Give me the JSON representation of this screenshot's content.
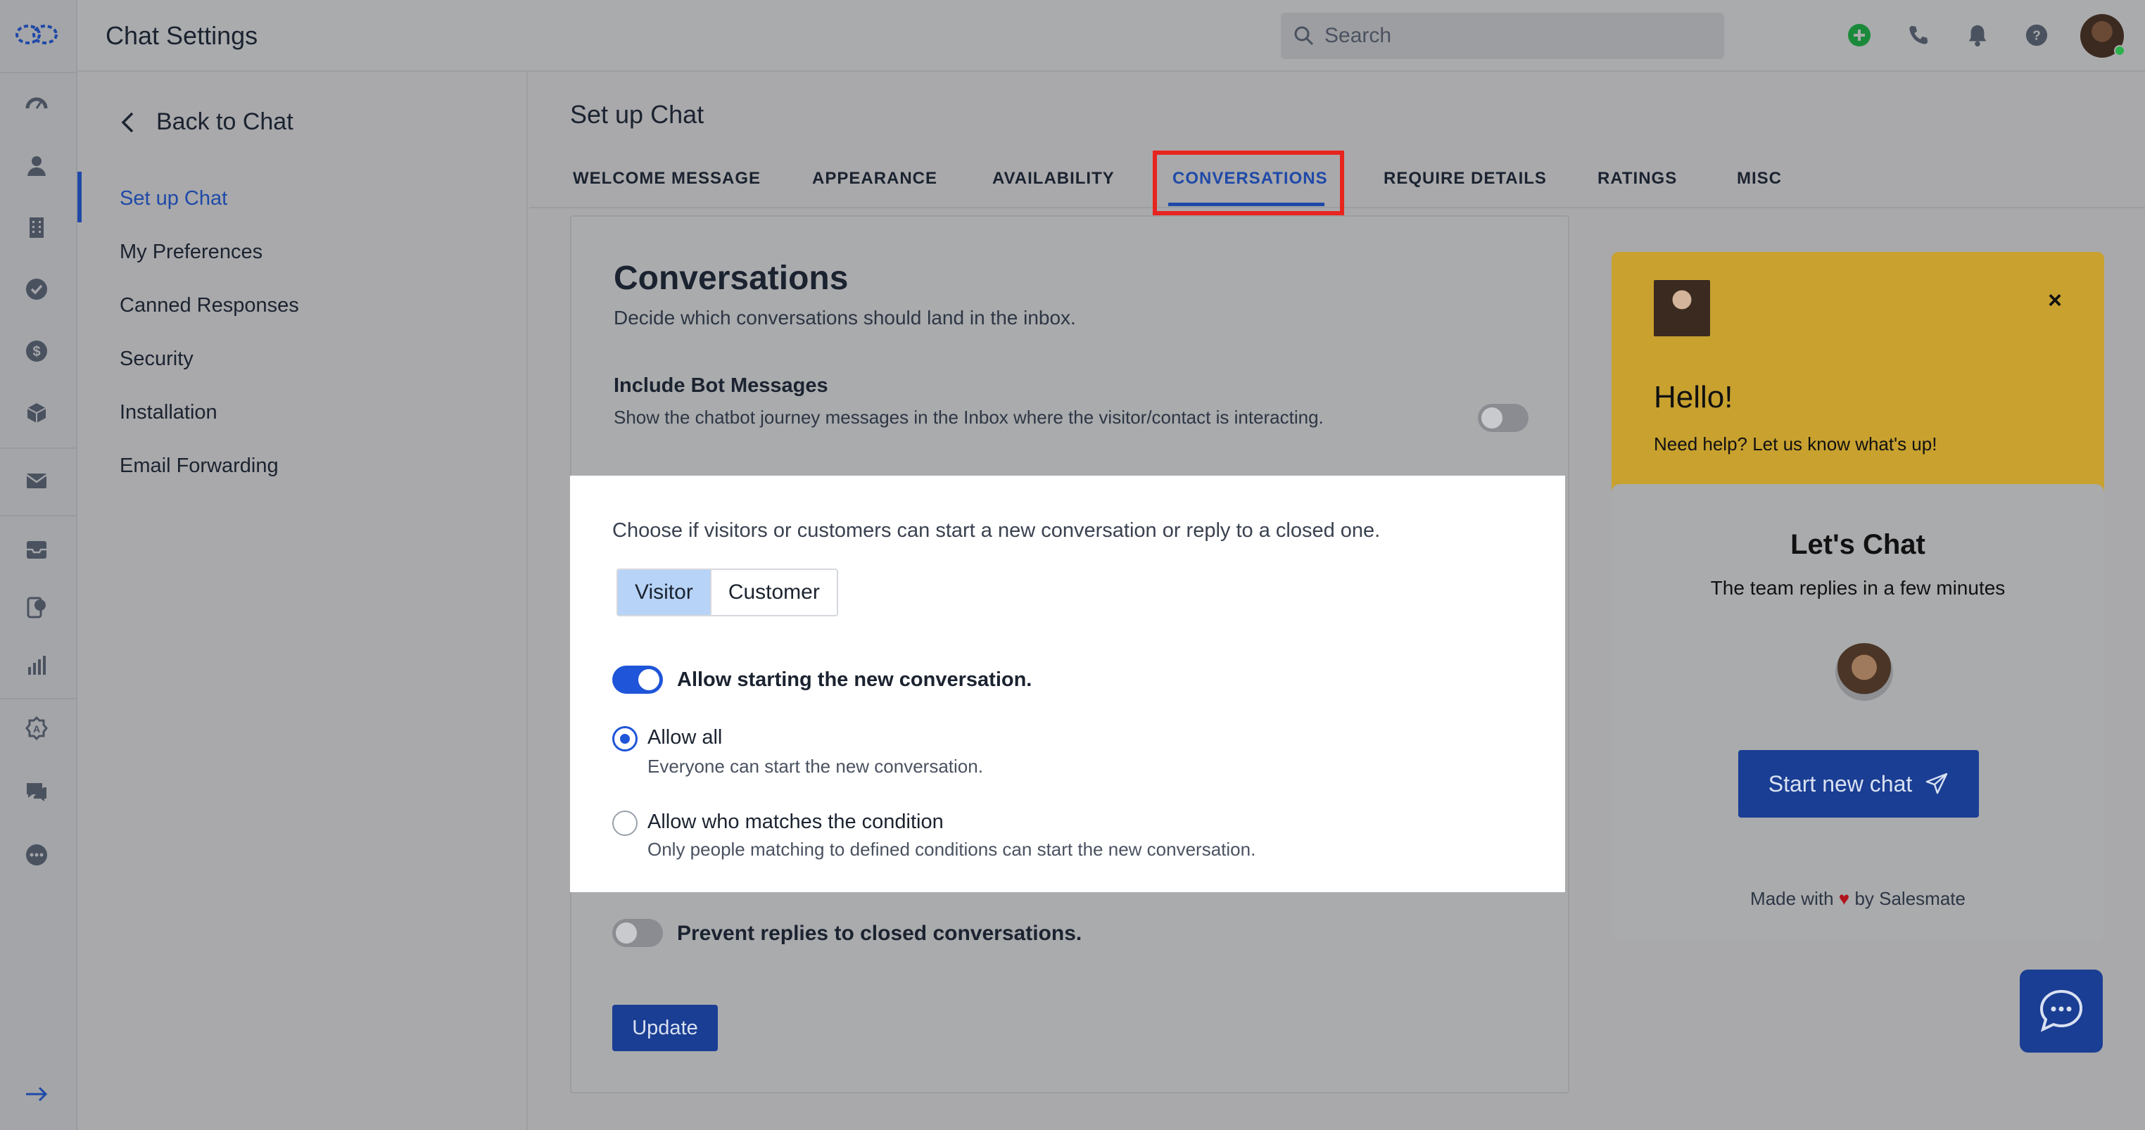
{
  "app": {
    "title": "Chat Settings"
  },
  "search": {
    "placeholder": "Search"
  },
  "sidenav": {
    "back_label": "Back to Chat",
    "items": [
      {
        "label": "Set up Chat",
        "active": true
      },
      {
        "label": "My Preferences"
      },
      {
        "label": "Canned Responses"
      },
      {
        "label": "Security"
      },
      {
        "label": "Installation"
      },
      {
        "label": "Email Forwarding"
      }
    ]
  },
  "main": {
    "title": "Set up Chat",
    "tabs": [
      {
        "label": "WELCOME MESSAGE"
      },
      {
        "label": "APPEARANCE"
      },
      {
        "label": "AVAILABILITY"
      },
      {
        "label": "CONVERSATIONS",
        "active": true
      },
      {
        "label": "REQUIRE DETAILS"
      },
      {
        "label": "RATINGS"
      },
      {
        "label": "MISC"
      }
    ]
  },
  "conversations": {
    "heading": "Conversations",
    "subheading": "Decide which conversations should land in the inbox.",
    "bot_title": "Include Bot Messages",
    "bot_desc": "Show the chatbot journey messages in the Inbox where the visitor/contact is interacting.",
    "bot_toggle_on": false,
    "choose_text": "Choose if visitors or customers can start a new conversation or reply to a closed one.",
    "segment": {
      "visitor": "Visitor",
      "customer": "Customer",
      "selected": "Visitor"
    },
    "allow_new_label": "Allow starting the new conversation.",
    "allow_new_on": true,
    "options": [
      {
        "label": "Allow all",
        "desc": "Everyone can start the new conversation.",
        "checked": true
      },
      {
        "label": "Allow who matches the condition",
        "desc": "Only people matching to defined conditions can start the new conversation.",
        "checked": false
      }
    ],
    "prevent_label": "Prevent replies to closed conversations.",
    "prevent_on": false,
    "update_label": "Update"
  },
  "widget": {
    "close_glyph": "×",
    "hello": "Hello!",
    "help": "Need help? Let us know what's up!",
    "lets_chat": "Let's Chat",
    "team_replies": "The team replies in a few minutes",
    "start_label": "Start new chat",
    "made_prefix": "Made with",
    "made_heart": "♥",
    "made_suffix": "by Salesmate",
    "header_color": "#c8a12f",
    "accent_color": "#1a3e93"
  },
  "colors": {
    "active": "#1f49a8",
    "highlight": "#e8241f"
  }
}
